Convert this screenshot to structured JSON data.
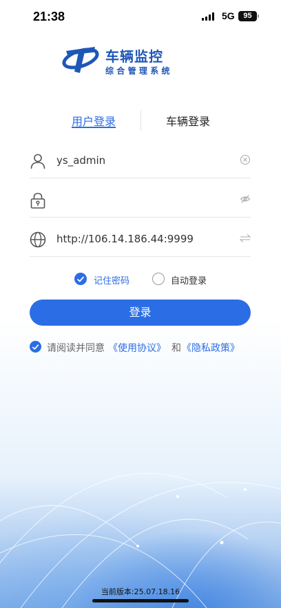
{
  "status_bar": {
    "time": "21:38",
    "network": "5G",
    "battery": "95"
  },
  "logo": {
    "title": "车辆监控",
    "subtitle": "综合管理系统"
  },
  "tabs": [
    {
      "label": "用户登录",
      "active": true
    },
    {
      "label": "车辆登录",
      "active": false
    }
  ],
  "form": {
    "username": "ys_admin",
    "password": "",
    "server": "http://106.14.186.44:9999"
  },
  "options": {
    "remember_password": "记住密码",
    "remember_checked": true,
    "auto_login": "自动登录",
    "auto_checked": false
  },
  "login_button": "登录",
  "agreement": {
    "prefix": "请阅读并同意",
    "user_agreement": "《使用协议》",
    "conjunction": "和",
    "privacy_policy": "《隐私政策》",
    "checked": true
  },
  "version": "当前版本:25.07.18.16",
  "colors": {
    "accent": "#2b6de5",
    "brand": "#1f57b8"
  },
  "icons": [
    "user-icon",
    "lock-icon",
    "globe-icon",
    "clear-icon",
    "eye-hidden-icon",
    "switch-icon",
    "check-icon"
  ]
}
